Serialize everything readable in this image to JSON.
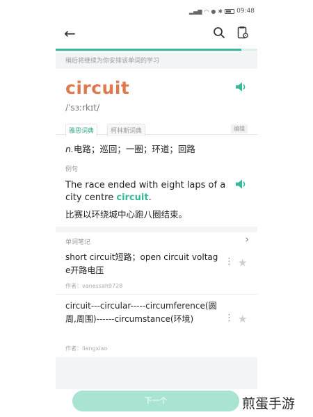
{
  "status_bar": {
    "time": "09:48"
  },
  "hint": "稍后将继续为你安排该单词的学习",
  "word": {
    "text": "circuit",
    "phonetic": "/ˈsɜːrkɪt/"
  },
  "tabs": [
    {
      "label": "雅思词典"
    },
    {
      "label": "柯林斯词典"
    }
  ],
  "tab_edit": "编辑",
  "definition": {
    "pos": "n.",
    "meaning": "电路；巡回；一圈；环道；回路"
  },
  "example": {
    "label": "例句",
    "en_before": "The race ended with eight laps of a city centre ",
    "en_highlight": "circuit",
    "en_after": ".",
    "cn": "比赛以环绕城中心跑八圈结束。"
  },
  "notes": {
    "label": "单词笔记",
    "items": [
      {
        "text": "short circuit短路；open circuit voltage开路电压",
        "author": "作者：vanessah9728"
      },
      {
        "text": "circuit---circular-----circumference(圆周,周围)------circumstance(环境)",
        "author": "作者：liangxiao"
      }
    ]
  },
  "next_button": "下一个",
  "watermark": "煎蛋手游",
  "progress": 0.92,
  "colors": {
    "accent": "#37b89a",
    "word": "#e0784e",
    "button": "#a8e3d3"
  }
}
